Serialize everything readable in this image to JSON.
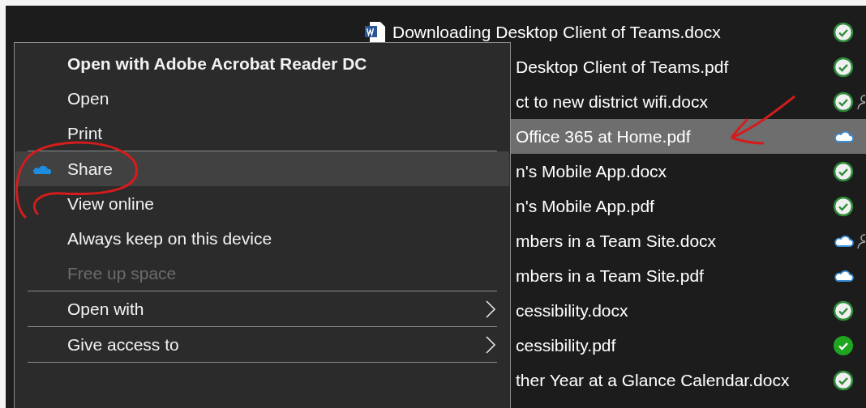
{
  "files": [
    {
      "name": "Downloading Desktop Client of Teams.docx",
      "word_icon": true,
      "partial": false,
      "cloud_only": false,
      "pinned": false,
      "shared": false,
      "selected": false
    },
    {
      "name": "Desktop Client of Teams.pdf",
      "word_icon": false,
      "partial": true,
      "cloud_only": false,
      "pinned": false,
      "shared": false,
      "selected": false
    },
    {
      "name": "ct to new district wifi.docx",
      "word_icon": false,
      "partial": true,
      "cloud_only": false,
      "pinned": false,
      "shared": true,
      "selected": false
    },
    {
      "name": "Office 365 at Home.pdf",
      "word_icon": false,
      "partial": true,
      "cloud_only": true,
      "pinned": false,
      "shared": false,
      "selected": true
    },
    {
      "name": "n's Mobile App.docx",
      "word_icon": false,
      "partial": true,
      "cloud_only": false,
      "pinned": false,
      "shared": false,
      "selected": false
    },
    {
      "name": "n's Mobile App.pdf",
      "word_icon": false,
      "partial": true,
      "cloud_only": false,
      "pinned": false,
      "shared": false,
      "selected": false
    },
    {
      "name": "mbers in a Team Site.docx",
      "word_icon": false,
      "partial": true,
      "cloud_only": true,
      "pinned": false,
      "shared": true,
      "selected": false
    },
    {
      "name": "mbers in a Team Site.pdf",
      "word_icon": false,
      "partial": true,
      "cloud_only": true,
      "pinned": false,
      "shared": false,
      "selected": false
    },
    {
      "name": "cessibility.docx",
      "word_icon": false,
      "partial": true,
      "cloud_only": false,
      "pinned": false,
      "shared": false,
      "selected": false
    },
    {
      "name": "cessibility.pdf",
      "word_icon": false,
      "partial": true,
      "cloud_only": false,
      "pinned": true,
      "shared": false,
      "selected": false
    },
    {
      "name": "ther Year at a Glance Calendar.docx",
      "word_icon": false,
      "partial": true,
      "cloud_only": false,
      "pinned": false,
      "shared": false,
      "selected": false
    }
  ],
  "context_menu": {
    "items": [
      {
        "kind": "item",
        "label": "Open with Adobe Acrobat Reader DC",
        "default": true,
        "selected": false,
        "disabled": false
      },
      {
        "kind": "item",
        "label": "Open",
        "default": false,
        "selected": false,
        "disabled": false
      },
      {
        "kind": "item",
        "label": "Print",
        "default": false,
        "selected": false,
        "disabled": false
      },
      {
        "kind": "separator"
      },
      {
        "kind": "icon_item",
        "label": "Share",
        "default": false,
        "selected": true,
        "disabled": false
      },
      {
        "kind": "item",
        "label": "View online",
        "default": false,
        "selected": false,
        "disabled": false
      },
      {
        "kind": "item",
        "label": "Always keep on this device",
        "default": false,
        "selected": false,
        "disabled": false
      },
      {
        "kind": "item",
        "label": "Free up space",
        "default": false,
        "selected": false,
        "disabled": true
      },
      {
        "kind": "separator"
      },
      {
        "kind": "submenu",
        "label": "Open with",
        "default": false,
        "selected": false,
        "disabled": false
      },
      {
        "kind": "separator"
      },
      {
        "kind": "submenu",
        "label": "Give access to",
        "default": false,
        "selected": false,
        "disabled": false
      },
      {
        "kind": "separator"
      }
    ]
  }
}
